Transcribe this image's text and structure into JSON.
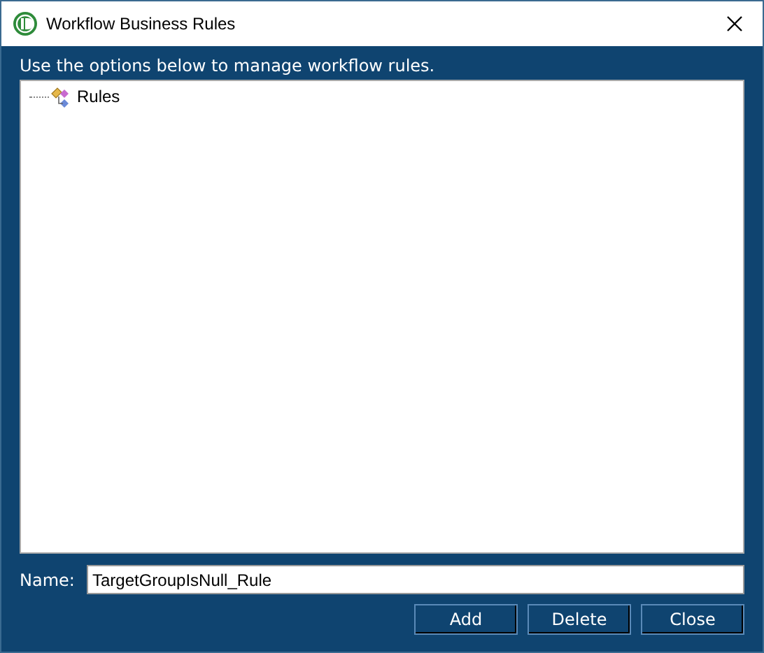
{
  "window": {
    "title": "Workflow Business Rules"
  },
  "instructions": "Use the options below to manage workflow rules.",
  "tree": {
    "items": [
      {
        "label": "Rules"
      }
    ]
  },
  "name_field": {
    "label": "Name:",
    "value": "TargetGroupIsNull_Rule"
  },
  "buttons": [
    "Add",
    "Delete",
    "Close"
  ]
}
